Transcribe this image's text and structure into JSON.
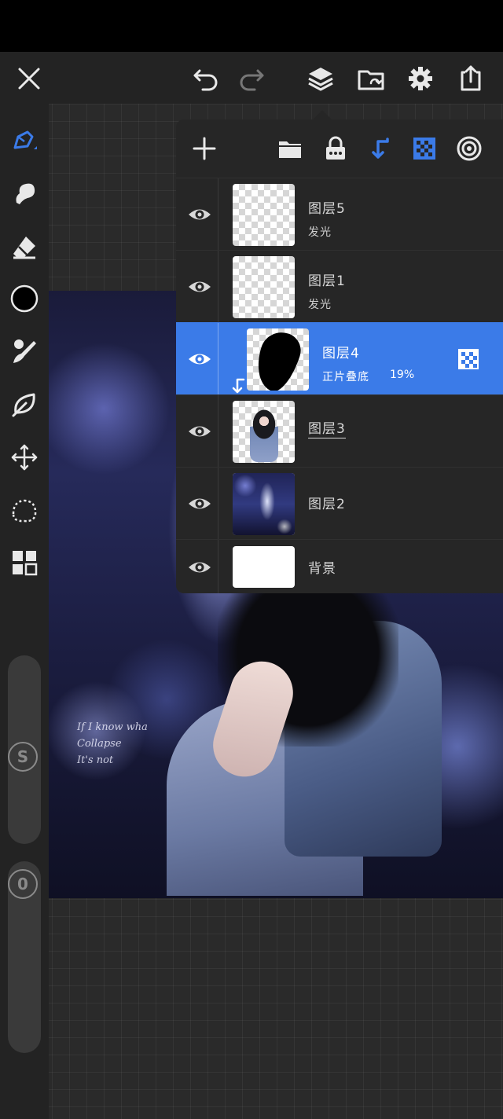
{
  "colors": {
    "accent": "#3b7be8",
    "toolbar_bg": "#232323",
    "panel_bg": "#262626",
    "icon": "#e8e8e8"
  },
  "top_toolbar": {
    "icons": [
      "close-icon",
      "undo-icon",
      "redo-icon",
      "layers-icon",
      "gallery-icon",
      "settings-icon",
      "share-icon"
    ]
  },
  "left_toolbar": {
    "tools": [
      "pen-tool-icon",
      "smudge-icon",
      "eraser-icon",
      "color-swatch",
      "brush-icon",
      "lasso-leaf-icon",
      "move-icon",
      "selection-icon",
      "grid-icon"
    ],
    "size_slider_label": "S",
    "opacity_slider_label": "0"
  },
  "canvas": {
    "text_lines": [
      "If I know wha",
      "Collapse",
      "It's not"
    ]
  },
  "layers_panel": {
    "toolbar_icons": [
      "add-icon",
      "folder-icon",
      "lock-icon",
      "clip-icon",
      "transparency-icon",
      "target-icon"
    ],
    "layers": [
      {
        "name": "图层5",
        "blend": "发光",
        "selected": false
      },
      {
        "name": "图层1",
        "blend": "发光",
        "selected": false
      },
      {
        "name": "图层4",
        "blend": "正片叠底",
        "opacity": "19%",
        "selected": true
      },
      {
        "name": "图层3",
        "blend": "",
        "selected": false
      },
      {
        "name": "图层2",
        "blend": "",
        "selected": false
      },
      {
        "name": "背景",
        "blend": "",
        "selected": false
      }
    ]
  }
}
